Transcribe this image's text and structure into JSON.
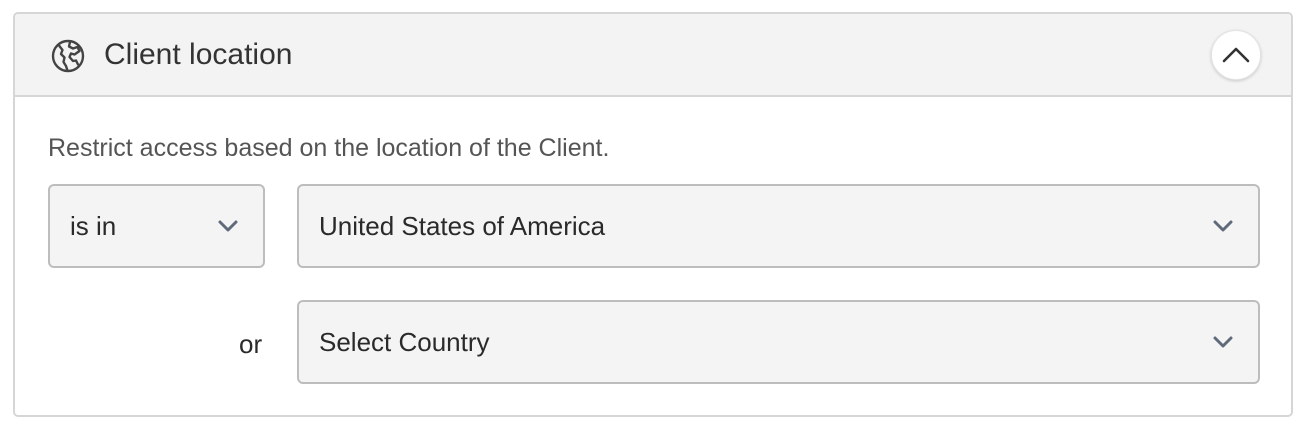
{
  "panel": {
    "title": "Client location",
    "title_icon": "globe-icon",
    "collapse_icon": "chevron-up-icon"
  },
  "description": "Restrict access based on the location of the Client.",
  "condition": {
    "operator": "is in",
    "countries": [
      "United States of America",
      "Select Country"
    ],
    "joiner": "or"
  },
  "icons": {
    "dropdown": "chevron-down-icon"
  },
  "colors": {
    "header_bg": "#f3f3f3",
    "border": "#d6d6d6",
    "field_bg": "#f4f4f4",
    "chevron": "#5f6b7a"
  }
}
